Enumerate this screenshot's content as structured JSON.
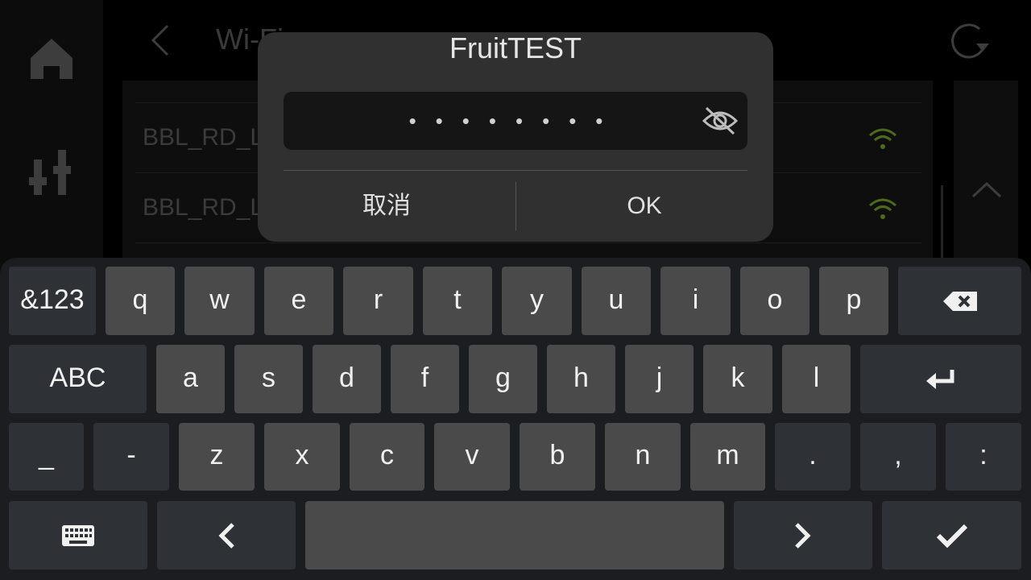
{
  "screen": {
    "title": "Wi-Fi",
    "networks": [
      {
        "ssid": "BBL_RD_La"
      },
      {
        "ssid": "BBL_RD_La"
      }
    ],
    "colors": {
      "wifi_signal": "#6b8e23"
    }
  },
  "dialog": {
    "network_name": "FruitTEST",
    "password_masked": "••••••••",
    "cancel_label": "取消",
    "ok_label": "OK"
  },
  "keyboard": {
    "row1": [
      "&123",
      "q",
      "w",
      "e",
      "r",
      "t",
      "y",
      "u",
      "i",
      "o",
      "p"
    ],
    "row2": [
      "ABC",
      "a",
      "s",
      "d",
      "f",
      "g",
      "h",
      "j",
      "k",
      "l"
    ],
    "row3": [
      "_",
      "-",
      "z",
      "x",
      "c",
      "v",
      "b",
      "n",
      "m",
      ".",
      ",",
      ":"
    ],
    "icons": [
      "backspace-icon",
      "enter-icon",
      "keyboard-hide-icon",
      "cursor-left-icon",
      "cursor-right-icon",
      "done-check-icon"
    ]
  }
}
